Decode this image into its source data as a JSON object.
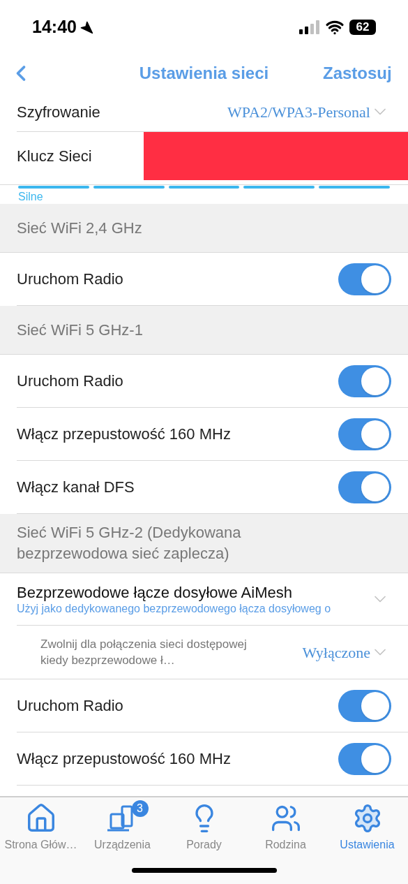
{
  "status_bar": {
    "time": "14:40",
    "battery": "62"
  },
  "nav": {
    "title": "Ustawienia sieci",
    "action": "Zastosuj"
  },
  "rows": [
    {
      "kind": "select",
      "label": "Szyfrowanie",
      "value": "WPA2/WPA3-Personal"
    },
    {
      "kind": "key",
      "label": "Klucz Sieci"
    },
    {
      "kind": "strength",
      "label": "Silne"
    },
    {
      "kind": "header",
      "label": "Sieć WiFi 2,4 GHz"
    },
    {
      "kind": "toggle",
      "label": "Uruchom Radio",
      "on": true
    },
    {
      "kind": "header",
      "label": "Sieć WiFi 5 GHz-1"
    },
    {
      "kind": "toggle",
      "label": "Uruchom Radio",
      "on": true
    },
    {
      "kind": "toggle",
      "label": "Włącz przepustowość 160 MHz",
      "on": true
    },
    {
      "kind": "toggle",
      "label": "Włącz kanał DFS",
      "on": true
    },
    {
      "kind": "header",
      "label": "Sieć WiFi 5 GHz-2 (Dedykowana bezprzewodowa sieć zaplecza)"
    },
    {
      "kind": "expand",
      "label": "Bezprzewodowe łącze dosyłowe AiMesh",
      "sublabel": "Użyj jako dedykowanego bezprzewodowego łącza dosyłoweg o"
    },
    {
      "kind": "subselect",
      "label": "Zwolnij dla połączenia sieci dostępowej kiedy bezprzewodowe ł…",
      "value": "Wyłączone"
    },
    {
      "kind": "toggle",
      "label": "Uruchom Radio",
      "on": true
    },
    {
      "kind": "toggle",
      "label": "Włącz przepustowość 160 MHz",
      "on": true
    }
  ],
  "tabs": [
    {
      "kind": "home",
      "label": "Strona Głów…",
      "selected": false
    },
    {
      "kind": "devices",
      "label": "Urządzenia",
      "badge": "3",
      "selected": false
    },
    {
      "kind": "tips",
      "label": "Porady",
      "selected": false
    },
    {
      "kind": "family",
      "label": "Rodzina",
      "selected": false
    },
    {
      "kind": "settings",
      "label": "Ustawienia",
      "selected": true
    }
  ]
}
